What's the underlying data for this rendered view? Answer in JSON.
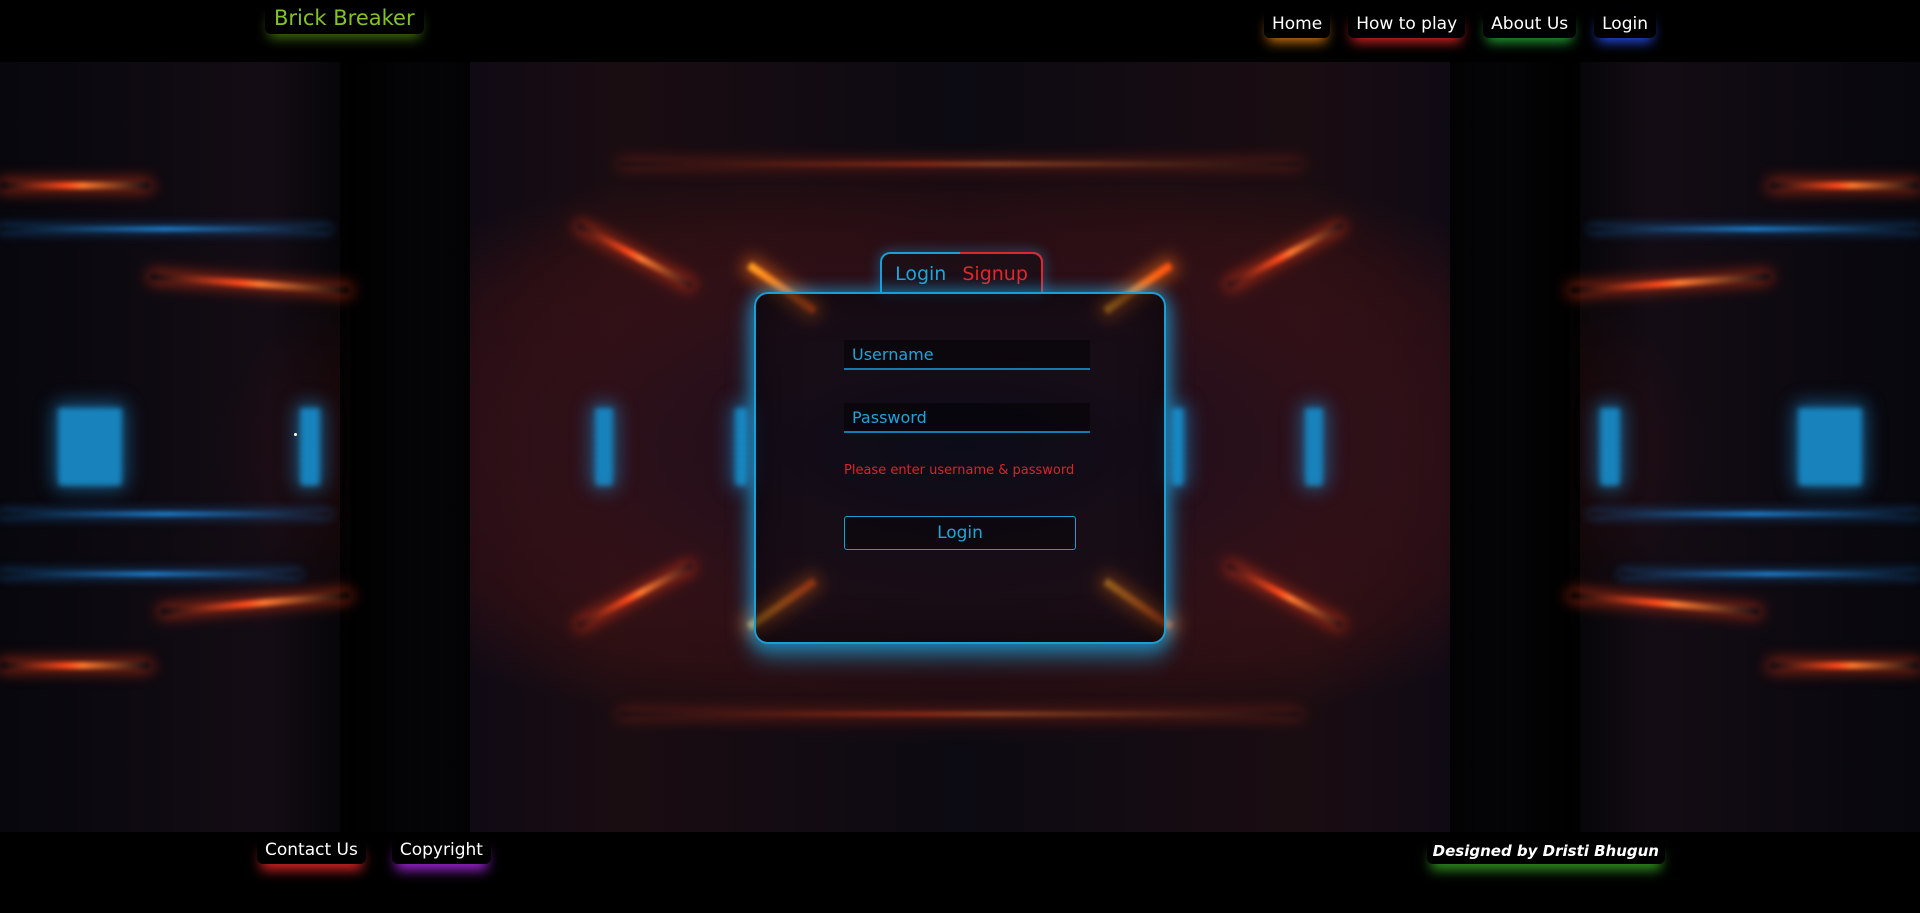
{
  "brand": {
    "title": "Brick Breaker"
  },
  "nav": {
    "items": [
      {
        "label": "Home"
      },
      {
        "label": "How to play"
      },
      {
        "label": "About Us"
      },
      {
        "label": "Login"
      }
    ]
  },
  "auth": {
    "tabs": {
      "login": "Login",
      "signup": "Signup"
    },
    "username_placeholder": "Username",
    "password_placeholder": "Password",
    "error_message": "Please enter username & password",
    "submit_label": "Login"
  },
  "footer": {
    "links": [
      {
        "label": "Contact Us"
      },
      {
        "label": "Copyright"
      }
    ],
    "credit": "Designed by Dristi Bhugun"
  },
  "colors": {
    "brand": "#83c326",
    "accent_cyan": "#1ba7dc",
    "accent_red": "#e8252a"
  }
}
